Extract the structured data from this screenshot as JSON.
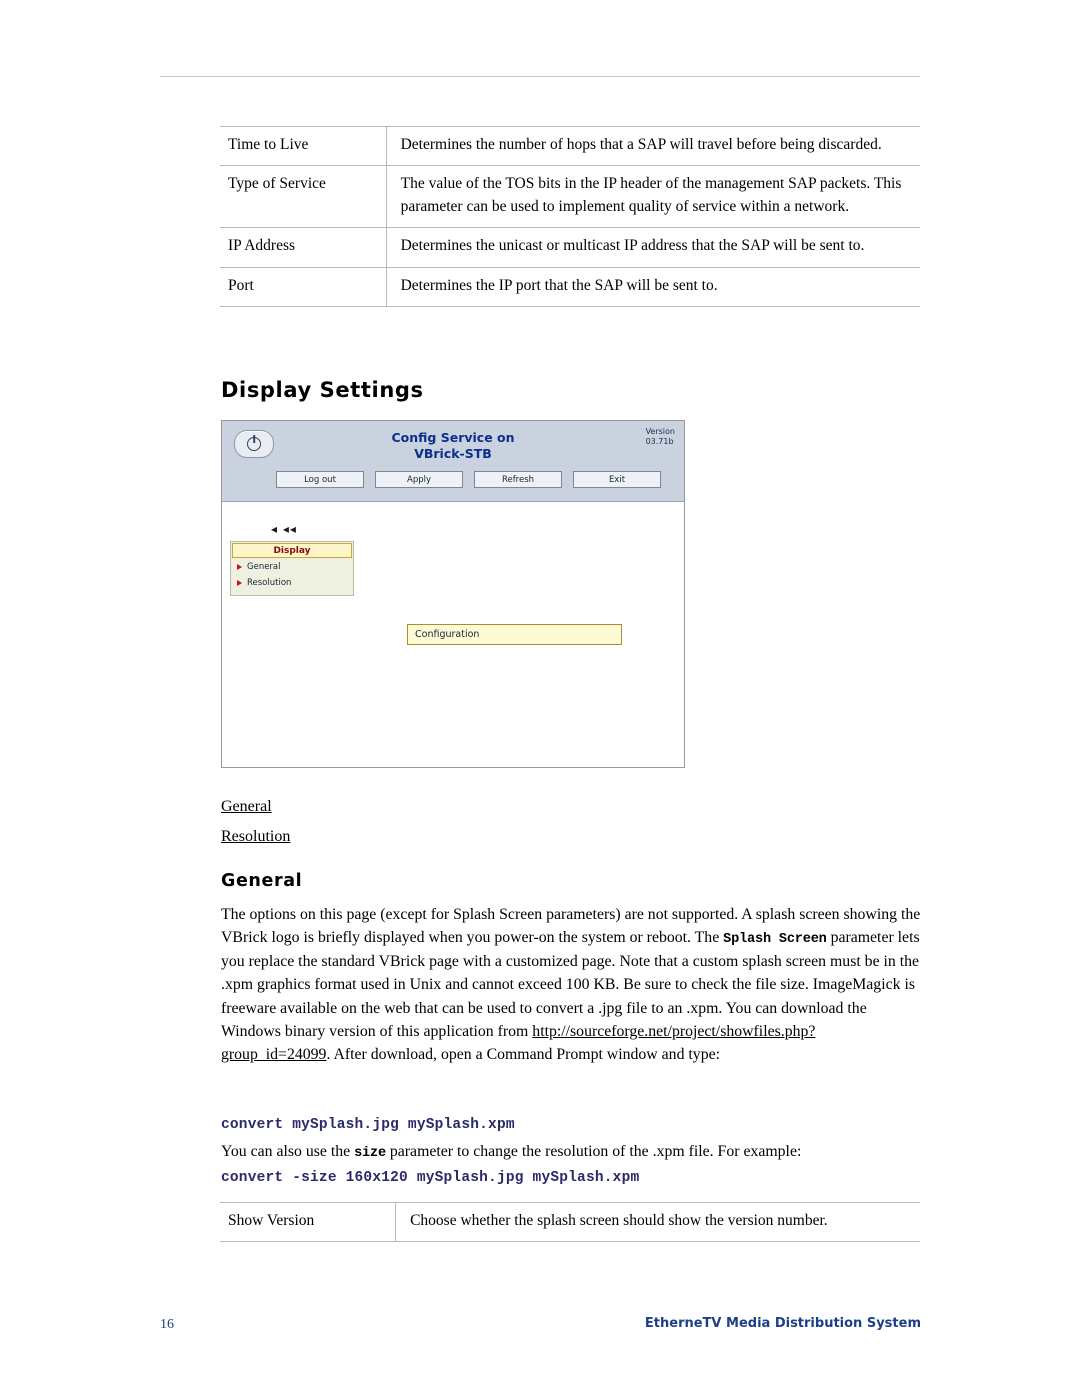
{
  "page": {
    "number": "16",
    "footer_title": "EtherneTV Media Distribution System"
  },
  "params_table": {
    "rows": [
      {
        "label": "Time to Live",
        "desc": "Determines the number of hops that a SAP will travel before being discarded."
      },
      {
        "label": "Type of Service",
        "desc": "The value of the TOS bits in the IP header of the management SAP packets. This parameter can be used to implement quality of service within a network."
      },
      {
        "label": "IP Address",
        "desc": "Determines the unicast or multicast IP address that the SAP will be sent to."
      },
      {
        "label": "Port",
        "desc": "Determines the IP port that the SAP will be sent to."
      }
    ]
  },
  "display_settings": {
    "heading": "Display Settings"
  },
  "screenshot": {
    "power_icon": "power-icon",
    "title_line1": "Config Service on",
    "title_line2": "VBrick-STB",
    "version_label": "Version",
    "version_value": "03.71b",
    "buttons": [
      "Log out",
      "Apply",
      "Refresh",
      "Exit"
    ],
    "arrows": "◂ ◂◂",
    "nav": {
      "selected": "Display",
      "items": [
        "General",
        "Resolution"
      ]
    },
    "config_box_label": "Configuration"
  },
  "links": {
    "general": "General",
    "resolution": "Resolution "
  },
  "general_section": {
    "heading": "General",
    "paragraph_1": "The options on this page (except for Splash Screen parameters) are not supported. A splash screen showing the VBrick logo is briefly displayed when you power-on the system or reboot. The ",
    "splash_screen_mono": "Splash Screen",
    "paragraph_2": " parameter lets you replace the standard VBrick page with a customized page. Note that a custom splash screen must be in the .xpm graphics format used in Unix and cannot exceed 100 KB. Be sure to check the file size. ImageMagick is freeware available on the web that can be used to convert a .jpg file to an .xpm. You can download the Windows binary version of this application from ",
    "url": "http://sourceforge.net/project/showfiles.php?group_id=24099",
    "paragraph_3": ". After download, open a Command Prompt window and type:",
    "code_1": "convert mySplash.jpg mySplash.xpm",
    "mid_paragraph_pre": "You can also use the ",
    "size_mono": "size",
    "mid_paragraph_post": " parameter to change the resolution of the .xpm file. For example:",
    "code_2": "convert -size 160x120 mySplash.jpg mySplash.xpm"
  },
  "show_version_table": {
    "rows": [
      {
        "label": "Show Version",
        "desc": "Choose whether the splash screen should show the version number."
      }
    ]
  }
}
